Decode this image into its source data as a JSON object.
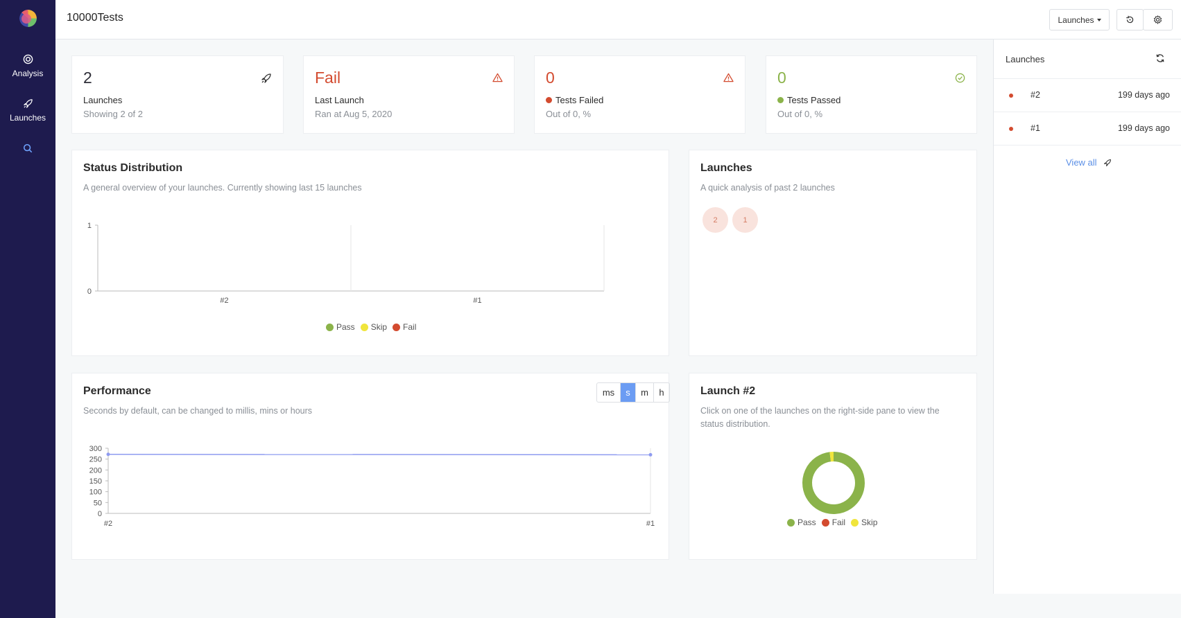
{
  "app": {
    "title": "10000Tests"
  },
  "sidebar": {
    "items": [
      {
        "label": "Analysis",
        "icon": "target-icon"
      },
      {
        "label": "Launches",
        "icon": "rocket-icon"
      },
      {
        "label": "",
        "icon": "search-icon"
      }
    ]
  },
  "header": {
    "launches_label": "Launches",
    "icons": [
      "history-icon",
      "gear-icon"
    ]
  },
  "stats": [
    {
      "value": "2",
      "label": "Launches",
      "sub": "Showing 2 of 2",
      "icon": "rocket-icon"
    },
    {
      "value": "Fail",
      "label": "Last Launch",
      "sub": "Ran at Aug 5, 2020",
      "icon": "warning-icon"
    },
    {
      "value": "0",
      "label": "Tests Failed",
      "sub": "Out of 0, %",
      "icon": "warning-icon"
    },
    {
      "value": "0",
      "label": "Tests Passed",
      "sub": "Out of 0, %",
      "icon": "check-circle-icon"
    }
  ],
  "status_distribution": {
    "title": "Status Distribution",
    "subtitle": "A general overview of your launches. Currently showing last 15 launches",
    "legend": [
      "Pass",
      "Skip",
      "Fail"
    ]
  },
  "launches_panel": {
    "title": "Launches",
    "subtitle": "A quick analysis of past 2 launches",
    "bubbles": [
      "2",
      "1"
    ]
  },
  "performance": {
    "title": "Performance",
    "subtitle": "Seconds by default, can be changed to millis, mins or hours",
    "units": [
      "ms",
      "s",
      "m",
      "h"
    ],
    "active_unit": "s"
  },
  "launch_detail": {
    "title": "Launch #2",
    "subtitle_1": "Click on one of the launches on the right-side pane to view the",
    "subtitle_2": "status distribution.",
    "legend": [
      "Pass",
      "Fail",
      "Skip"
    ]
  },
  "right_pane": {
    "title": "Launches",
    "rows": [
      {
        "name": "#2",
        "time": "199 days ago"
      },
      {
        "name": "#1",
        "time": "199 days ago"
      }
    ],
    "view_all": "View all"
  },
  "colors": {
    "pass": "#8bb34a",
    "skip": "#f0e53c",
    "fail": "#d34b2f",
    "line": "#8e9bf0",
    "sidebar": "#1e1b4e"
  },
  "chart_data": [
    {
      "type": "bar",
      "title": "Status Distribution",
      "categories": [
        "#2",
        "#1"
      ],
      "series": [
        {
          "name": "Pass",
          "values": [
            0,
            0
          ]
        },
        {
          "name": "Skip",
          "values": [
            0,
            0
          ]
        },
        {
          "name": "Fail",
          "values": [
            0,
            0
          ]
        }
      ],
      "ylim": [
        0,
        1
      ],
      "yticks": [
        0,
        1
      ],
      "legend": "bottom"
    },
    {
      "type": "line",
      "title": "Performance",
      "categories": [
        "#2",
        "#1"
      ],
      "series": [
        {
          "values": [
            272,
            270
          ]
        }
      ],
      "ylim": [
        0,
        300
      ],
      "yticks": [
        0,
        50,
        100,
        150,
        200,
        250,
        300
      ]
    },
    {
      "type": "pie",
      "title": "Launch #2",
      "labels": [
        "Pass",
        "Fail",
        "Skip"
      ],
      "values": [
        98,
        0,
        2
      ],
      "legend": "bottom"
    }
  ]
}
